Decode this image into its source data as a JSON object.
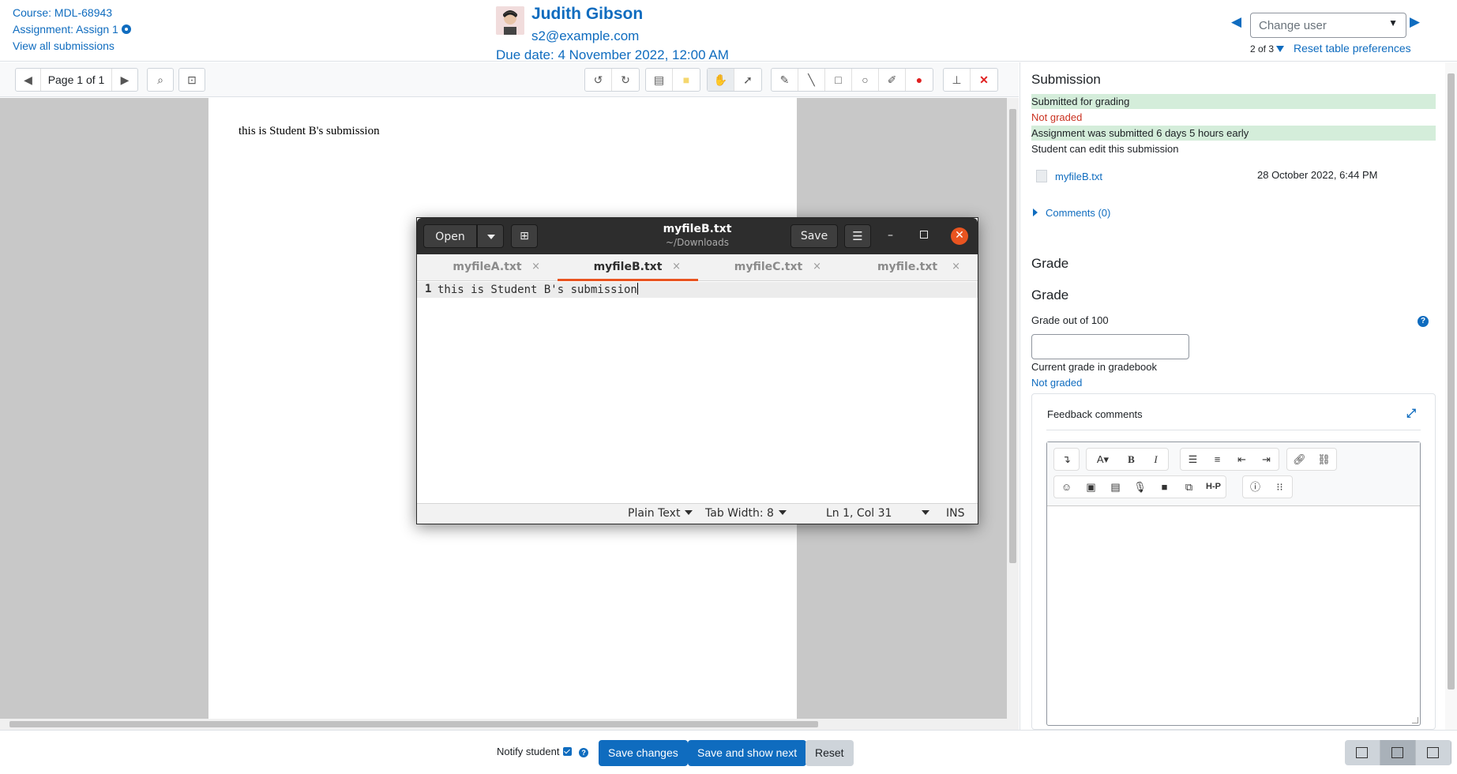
{
  "header": {
    "course": "Course: MDL-68943",
    "assignment": "Assignment: Assign 1",
    "view_all": "View all submissions",
    "user_name": "Judith Gibson",
    "user_email": "s2@example.com",
    "due_date": "Due date: 4 November 2022, 12:00 AM",
    "change_user_placeholder": "Change user",
    "page_count": "2 of 3",
    "reset_prefs": "Reset table preferences"
  },
  "toolbar": {
    "page_label": "Page 1 of 1"
  },
  "pdf": {
    "text": "this is Student B's submission"
  },
  "gedit": {
    "open_label": "Open",
    "title": "myfileB.txt",
    "subtitle": "~/Downloads",
    "save_label": "Save",
    "tabs": [
      {
        "label": "myfileA.txt",
        "active": false
      },
      {
        "label": "myfileB.txt",
        "active": true
      },
      {
        "label": "myfileC.txt",
        "active": false
      },
      {
        "label": "myfile.txt",
        "active": false
      }
    ],
    "line_number": "1",
    "line_content": "this is Student B's submission",
    "status": {
      "syntax": "Plain Text",
      "tab_width": "Tab Width: 8",
      "position": "Ln 1, Col 31",
      "mode": "INS"
    },
    "accent_color": "#e95420"
  },
  "submission": {
    "heading": "Submission",
    "status_submitted": "Submitted for grading",
    "status_graded": "Not graded",
    "status_timing": "Assignment was submitted 6 days 5 hours early",
    "status_edit": "Student can edit this submission",
    "file_name": "myfileB.txt",
    "file_date": "28 October 2022, 6:44 PM",
    "comments": "Comments (0)"
  },
  "grade": {
    "heading1": "Grade",
    "heading2": "Grade",
    "grade_label": "Grade out of 100",
    "grade_value": "",
    "gradebook_label": "Current grade in gradebook",
    "gradebook_value": "Not graded",
    "feedback_title": "Feedback comments"
  },
  "footer": {
    "notify_label": "Notify student",
    "save_changes": "Save changes",
    "save_and_next": "Save and show next",
    "reset": "Reset"
  },
  "colors": {
    "brand": "#0f6cbf",
    "success_bg": "#d4edda",
    "danger": "#ca3120"
  }
}
